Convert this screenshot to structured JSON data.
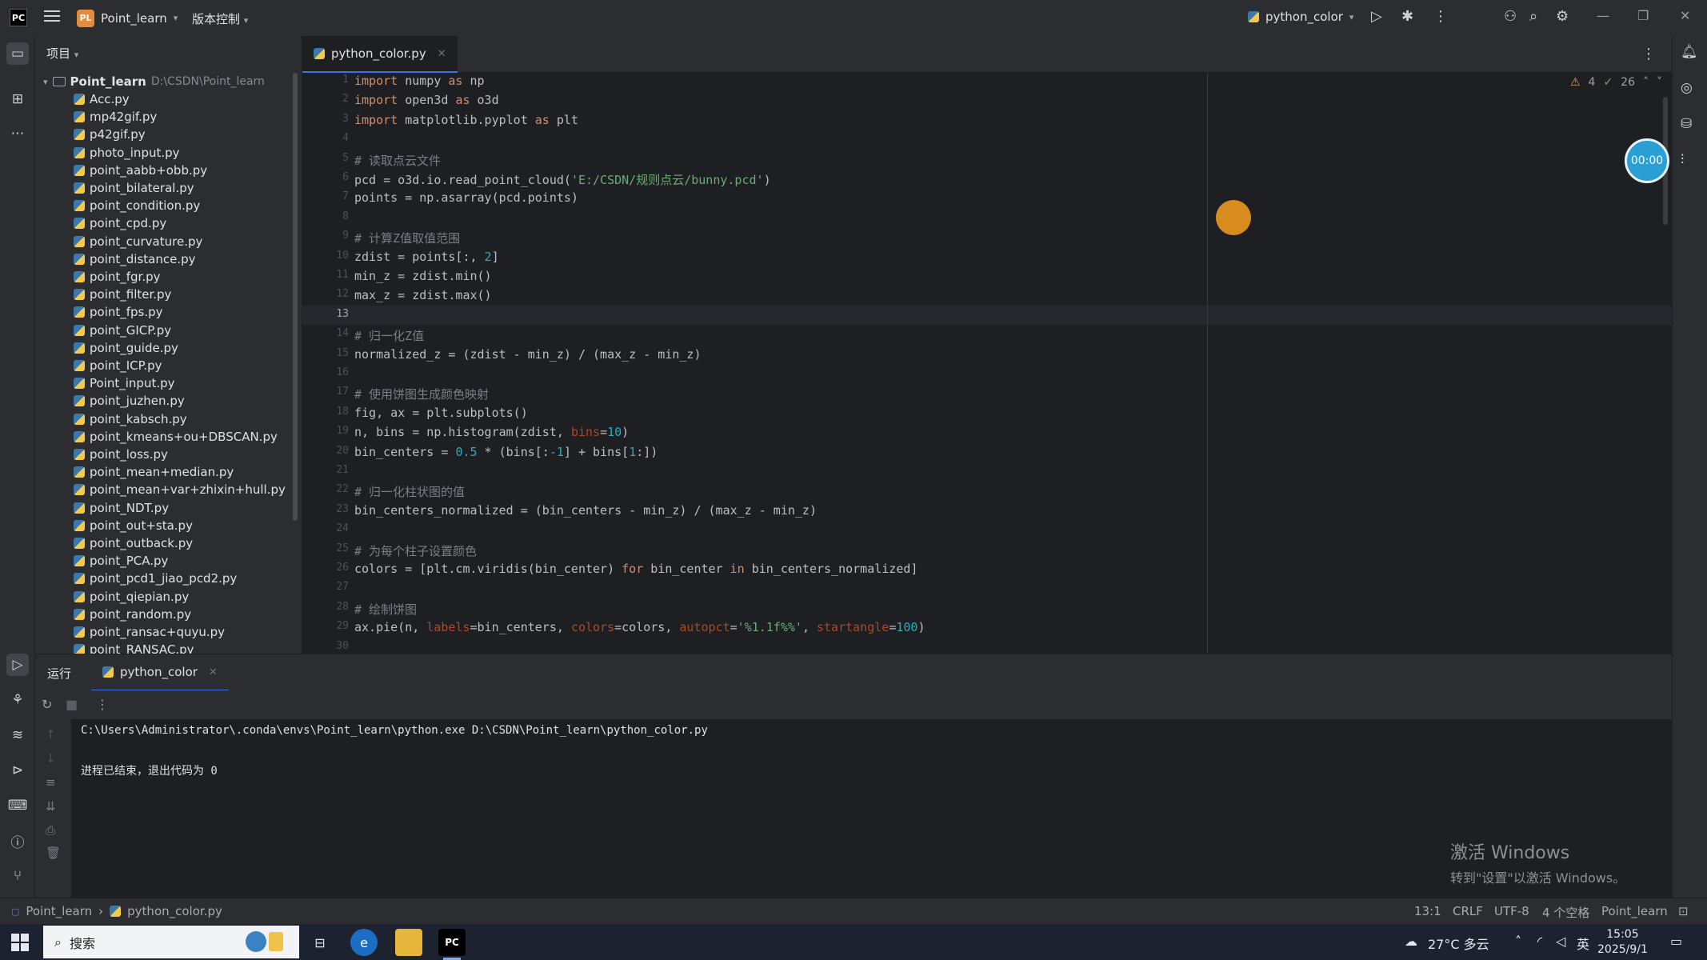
{
  "titlebar": {
    "project_badge": "PL",
    "project_name": "Point_learn",
    "vcs_label": "版本控制",
    "run_config": "python_color"
  },
  "project_panel": {
    "header": "项目",
    "root_name": "Point_learn",
    "root_path": "D:\\CSDN\\Point_learn",
    "files": [
      "Acc.py",
      "mp42gif.py",
      "p42gif.py",
      "photo_input.py",
      "point_aabb+obb.py",
      "point_bilateral.py",
      "point_condition.py",
      "point_cpd.py",
      "point_curvature.py",
      "point_distance.py",
      "point_fgr.py",
      "point_filter.py",
      "point_fps.py",
      "point_GICP.py",
      "point_guide.py",
      "point_ICP.py",
      "Point_input.py",
      "point_juzhen.py",
      "point_kabsch.py",
      "point_kmeans+ou+DBSCAN.py",
      "point_loss.py",
      "point_mean+median.py",
      "point_mean+var+zhixin+hull.py",
      "point_NDT.py",
      "point_out+sta.py",
      "point_outback.py",
      "point_PCA.py",
      "point_pcd1_jiao_pcd2.py",
      "point_qiepian.py",
      "point_random.py",
      "point_ransac+quyu.py",
      "point_RANSAC.py"
    ]
  },
  "editor": {
    "tab_label": "python_color.py",
    "warnings": "4",
    "checks": "26",
    "current_line": 13,
    "lines": [
      "import numpy as np",
      "import open3d as o3d",
      "import matplotlib.pyplot as plt",
      "",
      "# 读取点云文件",
      "pcd = o3d.io.read_point_cloud('E:/CSDN/规则点云/bunny.pcd')",
      "points = np.asarray(pcd.points)",
      "",
      "# 计算Z值取值范围",
      "zdist = points[:, 2]",
      "min_z = zdist.min()",
      "max_z = zdist.max()",
      "",
      "# 归一化Z值",
      "normalized_z = (zdist - min_z) / (max_z - min_z)",
      "",
      "# 使用饼图生成颜色映射",
      "fig, ax = plt.subplots()",
      "n, bins = np.histogram(zdist, bins=10)",
      "bin_centers = 0.5 * (bins[:-1] + bins[1:])",
      "",
      "# 归一化柱状图的值",
      "bin_centers_normalized = (bin_centers - min_z) / (max_z - min_z)",
      "",
      "# 为每个柱子设置颜色",
      "colors = [plt.cm.viridis(bin_center) for bin_center in bin_centers_normalized]",
      "",
      "# 绘制饼图",
      "ax.pie(n, labels=bin_centers, colors=colors, autopct='%1.1f%%', startangle=100)",
      ""
    ]
  },
  "timer": "00:00",
  "run_panel": {
    "title": "运行",
    "tab_label": "python_color",
    "console_lines": [
      "C:\\Users\\Administrator\\.conda\\envs\\Point_learn\\python.exe D:\\CSDN\\Point_learn\\python_color.py",
      "进程已结束，退出代码为 0"
    ]
  },
  "watermark": {
    "line1": "激活 Windows",
    "line2": "转到\"设置\"以激活 Windows。"
  },
  "statusbar": {
    "crumb_project": "Point_learn",
    "crumb_file": "python_color.py",
    "position": "13:1",
    "line_sep": "CRLF",
    "encoding": "UTF-8",
    "indent": "4 个空格",
    "interpreter": "Point_learn"
  },
  "taskbar": {
    "search_placeholder": "搜索",
    "weather": "27°C 多云",
    "ime": "英",
    "time": "15:05",
    "date": "2025/9/1"
  },
  "colors": {
    "accent": "#3574f0",
    "keyword": "#cf8e6d",
    "string": "#6aab73",
    "number": "#2aacb8",
    "comment": "#7a7e85"
  }
}
